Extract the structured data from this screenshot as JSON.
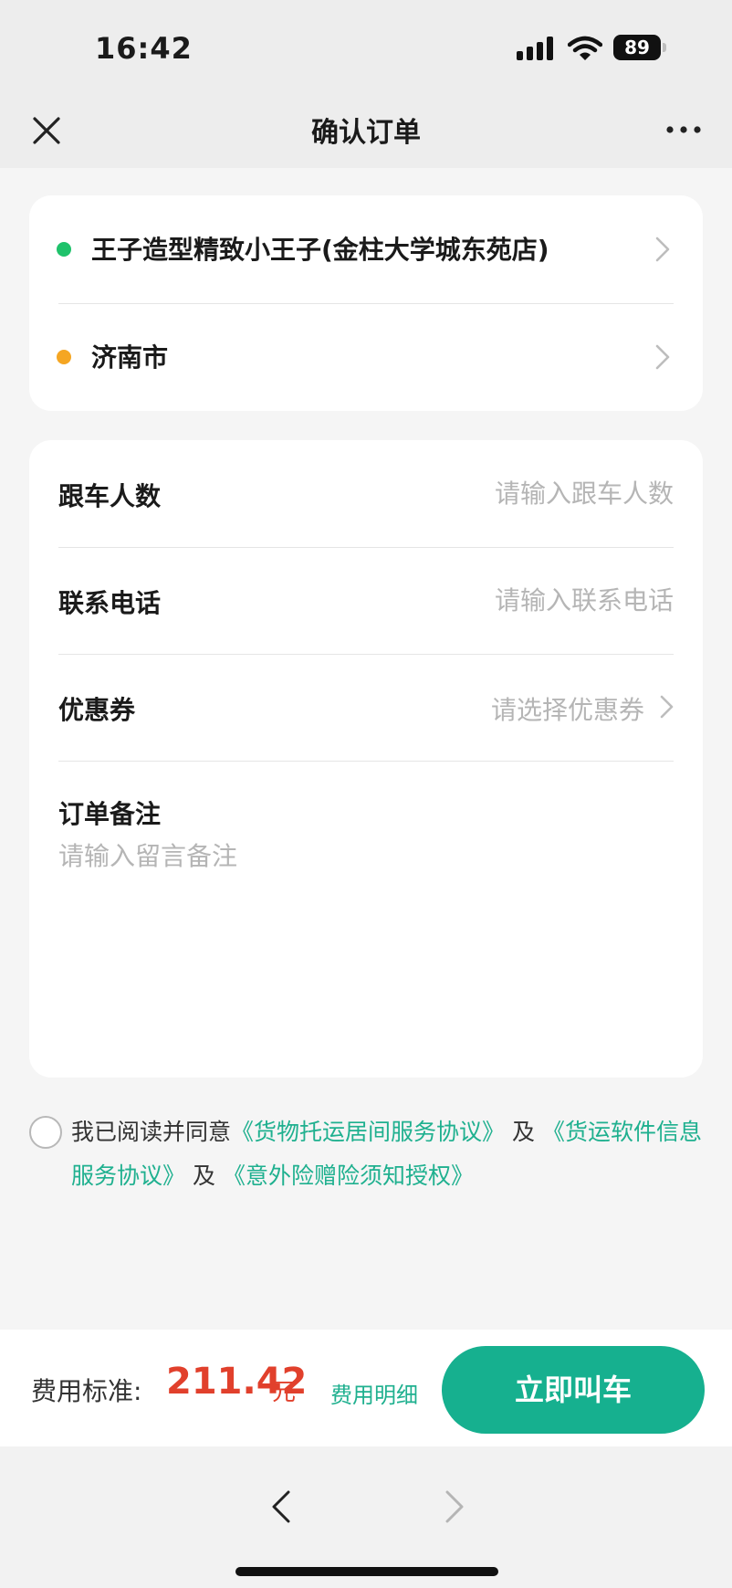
{
  "status_bar": {
    "time": "16:42",
    "battery": "89"
  },
  "nav": {
    "title": "确认订单",
    "close_icon": "close-icon",
    "more_icon": "more-icon"
  },
  "route": {
    "start": {
      "text": "王子造型精致小王子(金柱大学城东苑店)",
      "dot_color": "#1fc26b"
    },
    "end": {
      "text": "济南市",
      "dot_color": "#f5a623"
    }
  },
  "form": {
    "passengers": {
      "label": "跟车人数",
      "placeholder": "请输入跟车人数",
      "value": ""
    },
    "phone": {
      "label": "联系电话",
      "placeholder": "请输入联系电话",
      "value": ""
    },
    "coupon": {
      "label": "优惠券",
      "hint": "请选择优惠券"
    },
    "note": {
      "label": "订单备注",
      "placeholder": "请输入留言备注",
      "value": ""
    }
  },
  "agreement": {
    "checked": false,
    "prefix": "我已阅读并同意",
    "link1": "《货物托运居间服务协议》",
    "and1": "及",
    "link2": "《货运软件信息服务协议》",
    "and2": "及",
    "link3": "《意外险赠险须知授权》"
  },
  "footer": {
    "fee_label": "费用标准:",
    "fee_amount": "211.42",
    "fee_unit": "元",
    "fee_detail": "费用明细",
    "call_button": "立即叫车"
  },
  "colors": {
    "accent": "#16b08f",
    "price": "#e1402c"
  }
}
